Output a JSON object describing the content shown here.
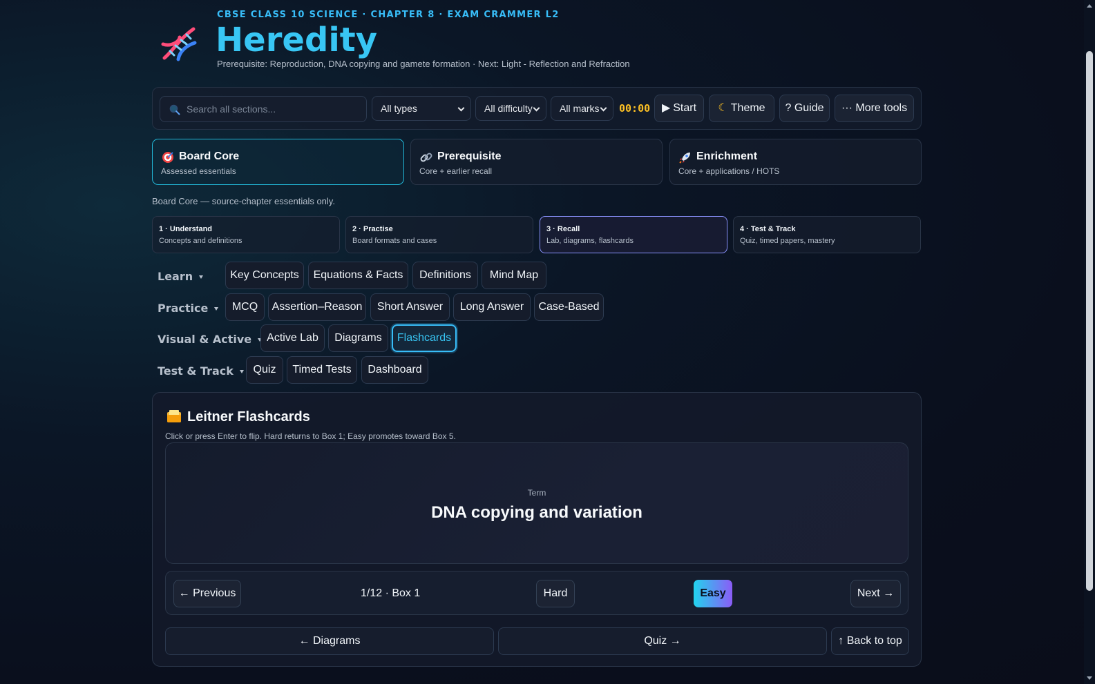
{
  "header": {
    "kicker": "CBSE CLASS 10 SCIENCE · CHAPTER 8 · EXAM CRAMMER L2",
    "title": "Heredity",
    "subtitle": "Prerequisite: Reproduction, DNA copying and gamete formation · Next: Light - Reflection and Refraction",
    "logo_icon": "dna-icon"
  },
  "toolbar": {
    "search_placeholder": "Search all sections...",
    "type_select": "All types",
    "difficulty_select": "All difficulty",
    "marks_select": "All marks",
    "timer": "00:00",
    "start_label": "Start",
    "theme_label": "Theme",
    "guide_label": "? Guide",
    "more_label": "··· More tools"
  },
  "tiers": [
    {
      "name": "Board Core",
      "sub": "Assessed essentials",
      "icon": "target-icon",
      "active": true
    },
    {
      "name": "Prerequisite",
      "sub": "Core + earlier recall",
      "icon": "link-icon",
      "active": false
    },
    {
      "name": "Enrichment",
      "sub": "Core + applications / HOTS",
      "icon": "rocket-icon",
      "active": false
    }
  ],
  "tier_note": "Board Core — source-chapter essentials only.",
  "steps": [
    {
      "name": "1 · Understand",
      "sub": "Concepts and definitions"
    },
    {
      "name": "2 · Practise",
      "sub": "Board formats and cases"
    },
    {
      "name": "3 · Recall",
      "sub": "Lab, diagrams, flashcards"
    },
    {
      "name": "4 · Test & Track",
      "sub": "Quiz, timed papers, mastery"
    }
  ],
  "nav": {
    "learn": {
      "label": "Learn",
      "items": [
        "Key Concepts",
        "Equations & Facts",
        "Definitions",
        "Mind Map"
      ]
    },
    "practice": {
      "label": "Practice",
      "items": [
        "MCQ",
        "Assertion–Reason",
        "Short Answer",
        "Long Answer",
        "Case-Based"
      ]
    },
    "visual": {
      "label": "Visual & Active",
      "items": [
        "Active Lab",
        "Diagrams",
        "Flashcards"
      ]
    },
    "test": {
      "label": "Test & Track",
      "items": [
        "Quiz",
        "Timed Tests",
        "Dashboard"
      ]
    },
    "active_item": "Flashcards"
  },
  "flashcards": {
    "title": "Leitner Flashcards",
    "help": "Click or press Enter to flip. Hard returns to Box 1; Easy promotes toward Box 5.",
    "card_kind": "Term",
    "card_term": "DNA copying and variation",
    "prev_label": "← Previous",
    "counter": "1/12 · Box 1",
    "hard_label": "Hard",
    "easy_label": "Easy",
    "next_label": "Next →",
    "back_section": "← Diagrams",
    "next_section": "Quiz →",
    "top_label": "↑ Back to top"
  },
  "colors": {
    "accent": "#38c6f4",
    "timer": "#fbbf24",
    "easy_gradient_start": "#22d3ee",
    "easy_gradient_end": "#8b5cf6"
  }
}
